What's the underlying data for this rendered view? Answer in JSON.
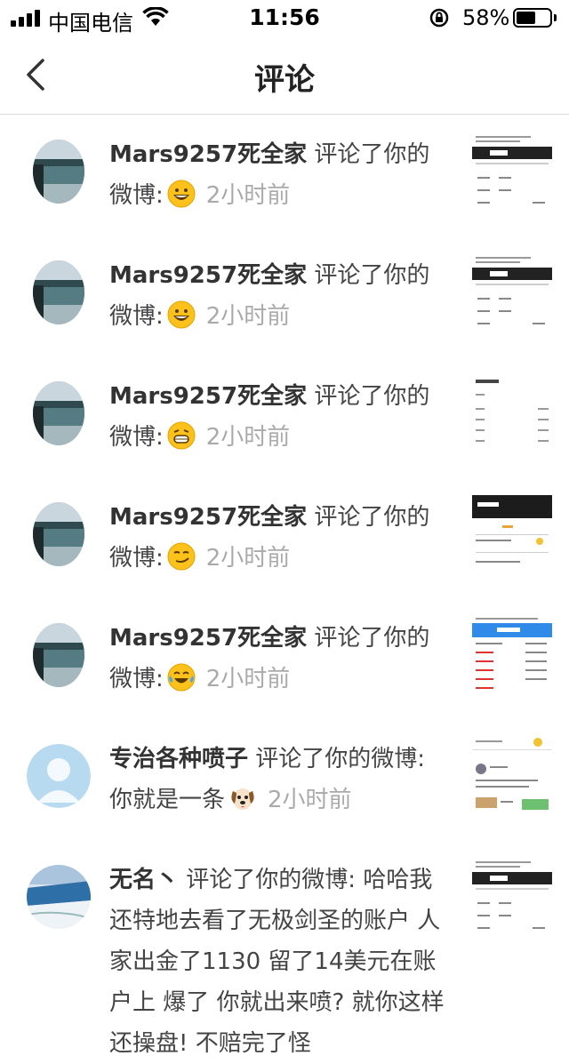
{
  "status_bar": {
    "carrier": "中国电信",
    "time": "11:56",
    "battery": "58%",
    "battery_level": 0.58
  },
  "header": {
    "title": "评论"
  },
  "items": [
    {
      "user": "Mars9257死全家",
      "action": "评论了你的微博:",
      "time": "2小时前",
      "emoji": "grinning-emoji"
    },
    {
      "user": "Mars9257死全家",
      "action": "评论了你的微博:",
      "time": "2小时前",
      "emoji": "grinning-emoji"
    },
    {
      "user": "Mars9257死全家",
      "action": "评论了你的微博:",
      "time": "2小时前",
      "emoji": "teeth-grin-emoji"
    },
    {
      "user": "Mars9257死全家",
      "action": "评论了你的微博:",
      "time": "2小时前",
      "emoji": "smirk-emoji"
    },
    {
      "user": "Mars9257死全家",
      "action": "评论了你的微博:",
      "time": "2小时前",
      "emoji": "tears-of-joy-emoji"
    },
    {
      "user": "专治各种喷子",
      "action": "评论了你的微博:",
      "text": "你就是一条",
      "time": "2小时前",
      "emoji": "dog-emoji"
    },
    {
      "user": "无名丶",
      "action": "评论了你的微博:",
      "text": "哈哈我还特地去看了无极剑圣的账户 人家出金了1130 留了14美元在账户上 爆了 你就出来喷? 就你这样还操盘! 不赔完了怪"
    }
  ]
}
